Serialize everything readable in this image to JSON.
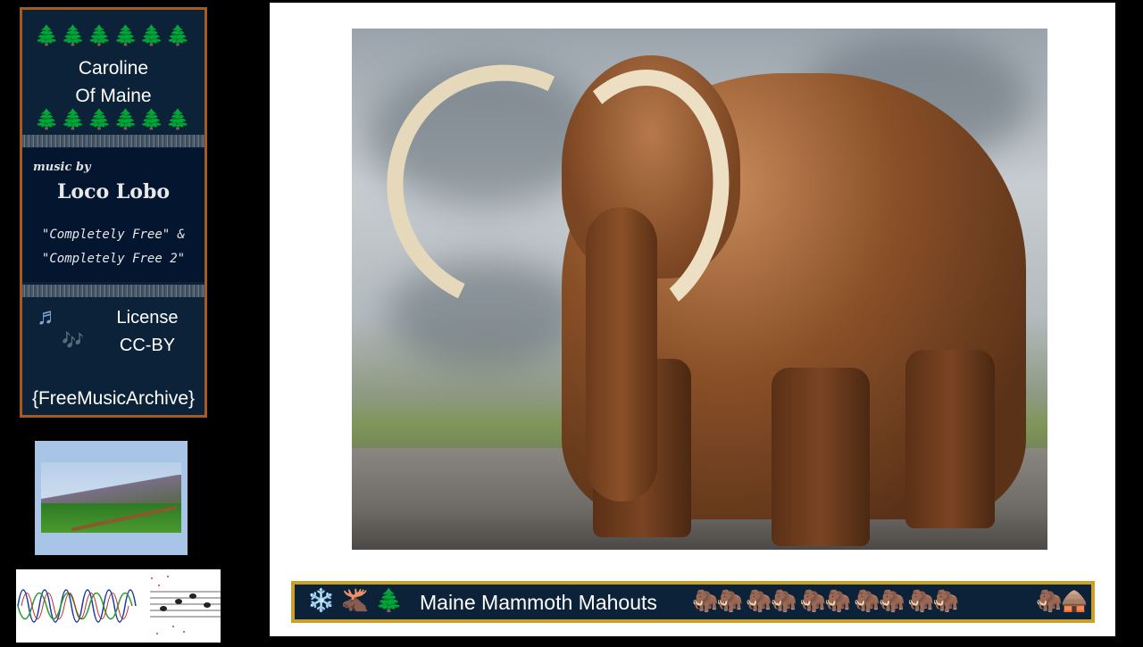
{
  "panel": {
    "trees": "🌲🌲🌲🌲🌲🌲",
    "title_line1": "Caroline",
    "title_line2": "Of Maine",
    "music_by": "music by",
    "artist": "Loco Lobo",
    "album_line1": "\"Completely Free\" &",
    "album_line2": "\"Completely Free 2\"",
    "license_line1": "License",
    "license_line2": "CC-BY",
    "source": "{FreeMusicArchive}",
    "note_single": "♬",
    "note_double": "🎶"
  },
  "banner": {
    "icons_left": "❄️ 🫎 🌲",
    "title": "Maine Mammoth Mahouts",
    "icons_right": "🦣🦣 🦣🦣 🦣🦣 🦣🦣 🦣🦣",
    "icons_end": "🦣🛖"
  },
  "colors": {
    "panel_bg": "#0b2238",
    "panel_border": "#a35a24",
    "banner_border": "#c9a12a",
    "tree": "#1c8a2a"
  }
}
